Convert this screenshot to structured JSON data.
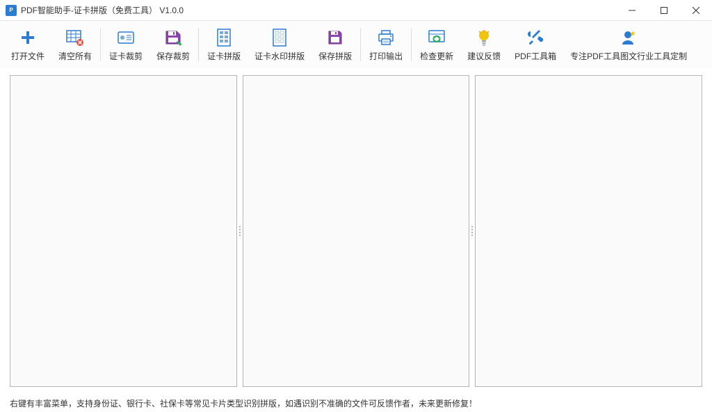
{
  "window": {
    "title": "PDF智能助手-证卡拼版（免费工具） V1.0.0"
  },
  "toolbar": {
    "open_file": "打开文件",
    "clear_all": "清空所有",
    "card_crop": "证卡裁剪",
    "save_crop": "保存裁剪",
    "card_layout": "证卡拼版",
    "card_watermark_layout": "证卡水印拼版",
    "save_layout": "保存拼版",
    "print_output": "打印输出",
    "check_update": "检查更新",
    "feedback": "建议反馈",
    "pdf_toolbox": "PDF工具箱",
    "custom_tools": "专注PDF工具图文行业工具定制"
  },
  "statusbar": {
    "text": "右键有丰富菜单，支持身份证、银行卡、社保卡等常见卡片类型识别拼版，如遇识别不准确的文件可反馈作者，未来更新修复！"
  }
}
